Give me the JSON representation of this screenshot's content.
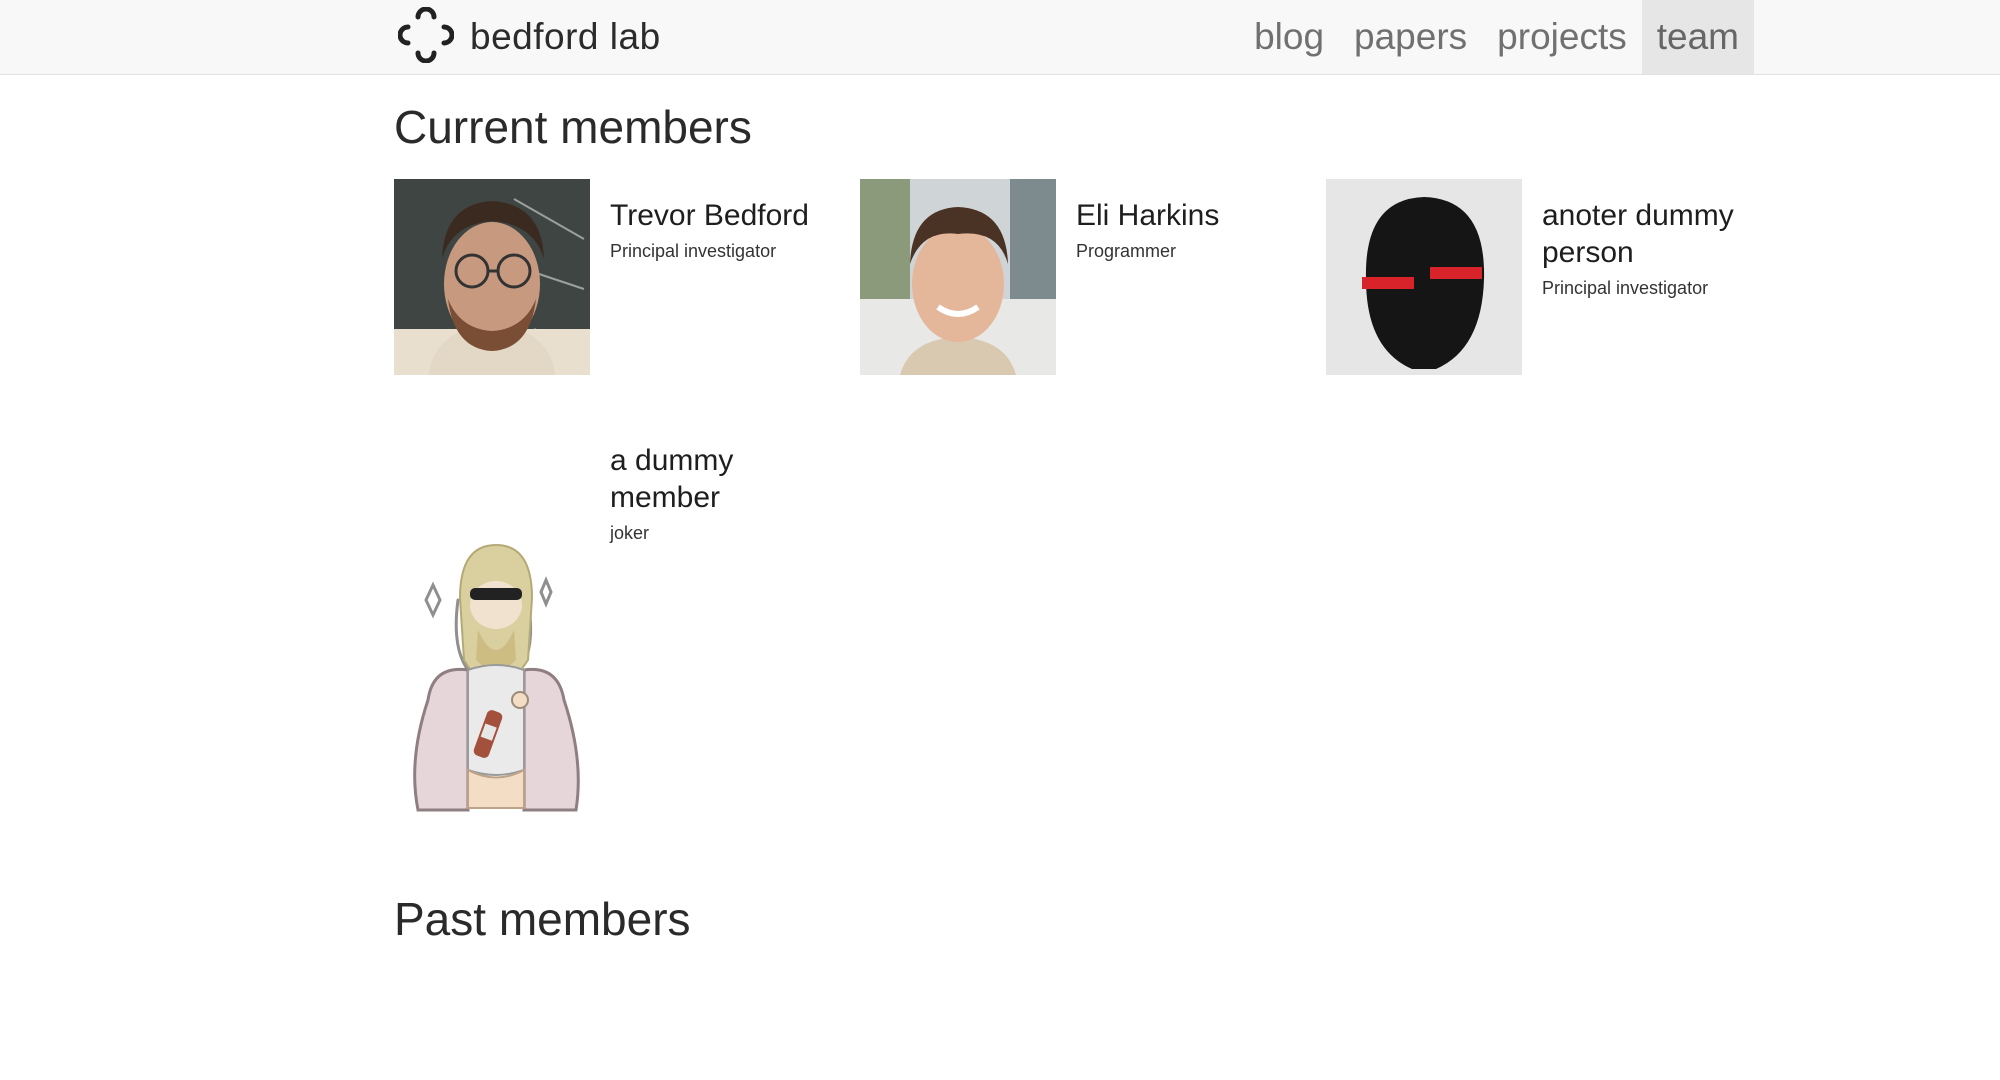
{
  "brand": {
    "name": "bedford lab",
    "logo_icon": "lab-logo-icon"
  },
  "nav": {
    "items": [
      {
        "label": "blog",
        "active": false
      },
      {
        "label": "papers",
        "active": false
      },
      {
        "label": "projects",
        "active": false
      },
      {
        "label": "team",
        "active": true
      }
    ]
  },
  "sections": {
    "current": "Current members",
    "past": "Past members"
  },
  "members": [
    {
      "name": "Trevor Bedford",
      "role": "Principal investigator"
    },
    {
      "name": "Eli Harkins",
      "role": "Programmer"
    },
    {
      "name": "anoter dummy person",
      "role": "Principal investigator"
    },
    {
      "name": "a dummy member",
      "role": "joker"
    }
  ],
  "colors": {
    "navbar_bg": "#f8f8f8",
    "nav_active_bg": "#e6e6e6",
    "nav_text": "#707070",
    "accent_red": "#d8232a"
  }
}
